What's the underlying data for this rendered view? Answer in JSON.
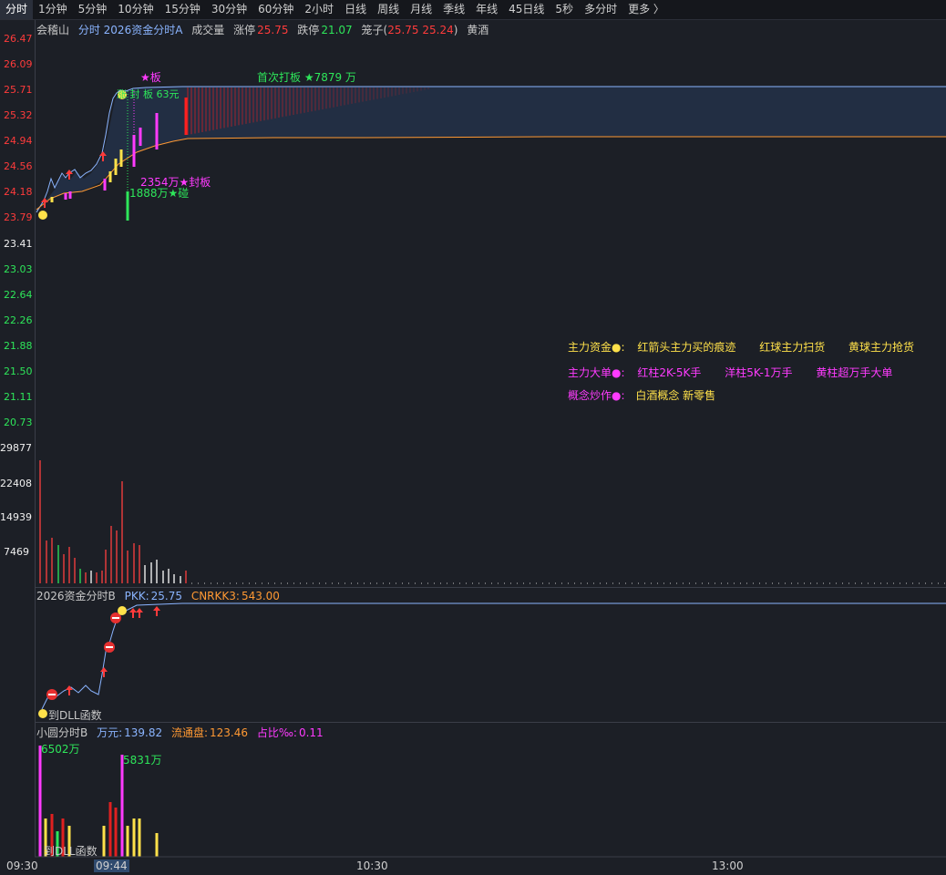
{
  "tabs": [
    "分时",
    "1分钟",
    "5分钟",
    "10分钟",
    "15分钟",
    "30分钟",
    "60分钟",
    "2小时",
    "日线",
    "周线",
    "月线",
    "季线",
    "年线",
    "45日线",
    "5秒",
    "多分时",
    "更多 〉"
  ],
  "main_header": {
    "stock_name": "会稽山",
    "indicator": "分时 2026资金分时A",
    "volume_label": "成交量",
    "limit_up_label": "涨停",
    "limit_up_value": "25.75",
    "limit_down_label": "跌停",
    "limit_down_value": "21.07",
    "cage_label": "笼子(",
    "cage_values": "25.75 25.24",
    "cage_close": ")",
    "sector": "黄酒"
  },
  "price_axis": {
    "red_labels": [
      "26.47",
      "26.09",
      "25.71",
      "25.32",
      "24.94",
      "24.56",
      "24.18",
      "23.79"
    ],
    "base_label": "23.41",
    "green_labels": [
      "23.03",
      "22.64",
      "22.26",
      "21.88",
      "21.50",
      "21.11",
      "20.73"
    ]
  },
  "volume_axis": [
    "29877",
    "22408",
    "14939",
    "7469"
  ],
  "annotations": {
    "star_board": "★板",
    "first_board": "首次打板 ★7879 万",
    "peak_tag": "涨 封 板 63元",
    "seal_board": "2354万★封板",
    "open_board": "1888万★碰"
  },
  "legend": {
    "row1": [
      "主力资金●:",
      "红箭头主力买的痕迹",
      "红球主力扫货",
      "黄球主力抢货"
    ],
    "row2": [
      "主力大单●:",
      "红柱2K-5K手",
      "洋柱5K-1万手",
      "黄柱超万手大单"
    ],
    "row3_label": "概念炒作●:",
    "row3_value": "白酒概念 新零售"
  },
  "panel_b_header": {
    "name": "2026资金分时B",
    "pkk_label": "PKK:",
    "pkk_value": "25.75",
    "cnrkk_label": "CNRKK3:",
    "cnrkk_value": "543.00"
  },
  "panel_b_note": "到DLL函数",
  "panel_c_header": {
    "name": "小圆分时B",
    "wan_label": "万元:",
    "wan_value": "139.82",
    "float_label": "流通盘:",
    "float_value": "123.46",
    "ratio_label": "占比‰:",
    "ratio_value": "0.11"
  },
  "panel_c_labels": {
    "bar1": "6502万",
    "bar2": "5831万",
    "note": "到DLL函数"
  },
  "x_axis": {
    "t0": "09:30",
    "t1": "09:44",
    "t2": "10:30",
    "t3": "13:00"
  },
  "colors": {
    "up": "#ff3b3b",
    "down": "#2ee65a",
    "line": "#8ab4ff",
    "avg": "#ff9933",
    "magenta": "#ff3bff",
    "yellow": "#ffe14a"
  },
  "chart_data": {
    "type": "line",
    "series": [
      {
        "values": [
          23.79,
          24.0,
          24.38,
          24.22,
          24.35,
          24.28,
          24.35,
          24.43,
          24.32,
          24.44,
          24.6,
          24.95,
          25.65,
          25.75,
          25.7,
          25.75,
          25.75,
          25.75
        ]
      }
    ],
    "ylim": [
      20.73,
      26.47
    ]
  }
}
